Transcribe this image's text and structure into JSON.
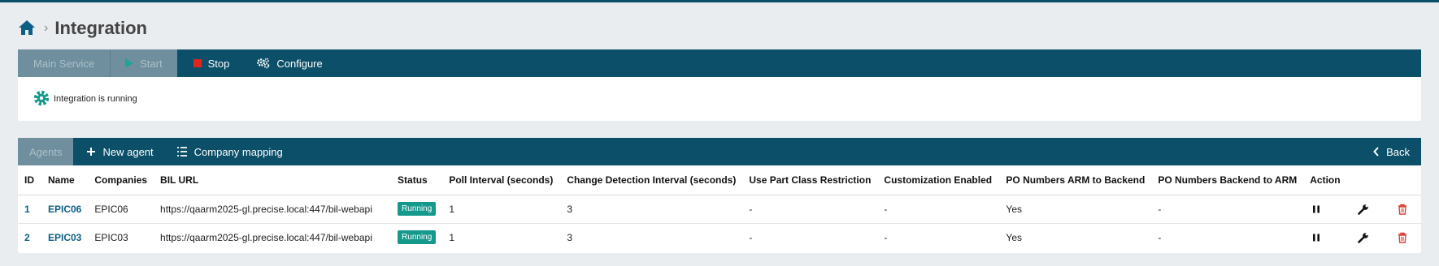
{
  "breadcrumb": {
    "title": "Integration"
  },
  "service_toolbar": {
    "main_service": "Main Service",
    "start": "Start",
    "stop": "Stop",
    "configure": "Configure"
  },
  "status_message": "Integration is running",
  "agents_toolbar": {
    "agents": "Agents",
    "new_agent": "New agent",
    "company_mapping": "Company mapping",
    "back": "Back"
  },
  "table": {
    "headers": [
      "ID",
      "Name",
      "Companies",
      "BIL URL",
      "Status",
      "Poll Interval (seconds)",
      "Change Detection Interval (seconds)",
      "Use Part Class Restriction",
      "Customization Enabled",
      "PO Numbers ARM to Backend",
      "PO Numbers Backend to ARM",
      "Action"
    ],
    "rows": [
      {
        "id": "1",
        "name": "EPIC06",
        "companies": "EPIC06",
        "url": "https://qaarm2025-gl.precise.local:447/bil-webapi",
        "status": "Running",
        "poll": "1",
        "change": "3",
        "part_class": "-",
        "custom": "-",
        "po_arm_backend": "Yes",
        "po_backend_arm": "-"
      },
      {
        "id": "2",
        "name": "EPIC03",
        "companies": "EPIC03",
        "url": "https://qaarm2025-gl.precise.local:447/bil-webapi",
        "status": "Running",
        "poll": "1",
        "change": "3",
        "part_class": "-",
        "custom": "-",
        "po_arm_backend": "Yes",
        "po_backend_arm": "-"
      }
    ]
  },
  "colors": {
    "toolbar": "#0b4f68",
    "badge": "#16998d",
    "link": "#0b5f86",
    "stop": "#e0261d",
    "delete": "#d9443a"
  }
}
